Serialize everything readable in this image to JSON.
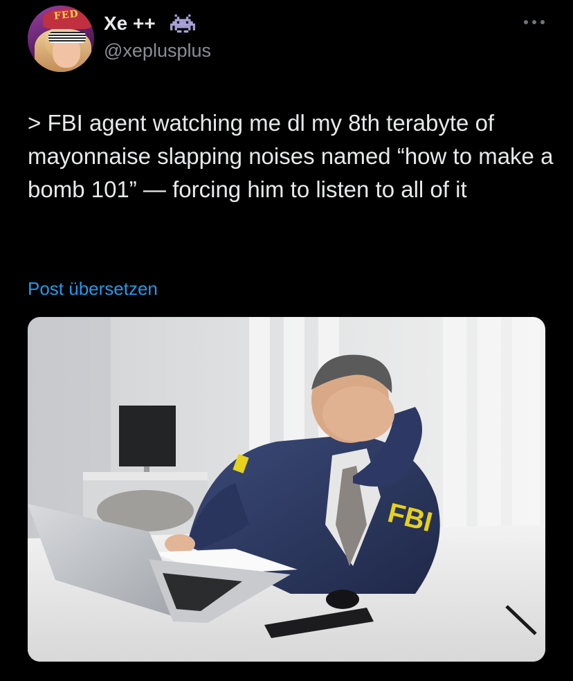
{
  "author": {
    "display_name": "Xe ++",
    "handle": "@xeplusplus",
    "badge_icon": "space-invader-icon",
    "avatar_hat_text": "FED"
  },
  "tweet": {
    "text": "> FBI agent watching me dl my 8th terabyte of mayonnaise slapping noises named “how to make a bomb 101” — forcing him to listen to all of it",
    "translate_label": "Post übersetzen"
  },
  "media": {
    "jacket_text": "FBI",
    "alt": "photo-facepalm-agent"
  },
  "colors": {
    "background": "#000000",
    "text": "#e7e9ea",
    "secondary": "#8a8f95",
    "link": "#1d9bf0"
  }
}
